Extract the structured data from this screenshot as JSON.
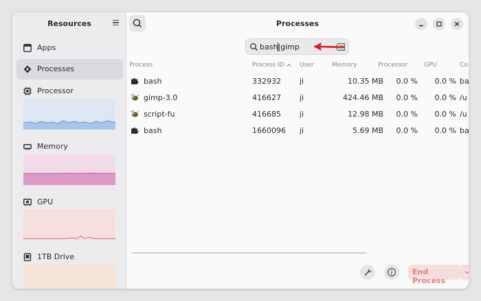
{
  "sidebar": {
    "title": "Resources",
    "items": [
      {
        "label": "Apps",
        "icon": "window-icon"
      },
      {
        "label": "Processes",
        "icon": "process-icon"
      },
      {
        "label": "Processor",
        "icon": "cpu-icon"
      },
      {
        "label": "Memory",
        "icon": "ram-icon"
      },
      {
        "label": "GPU",
        "icon": "gpu-icon"
      },
      {
        "label": "1TB Drive",
        "icon": "drive-icon"
      }
    ]
  },
  "header": {
    "title": "Processes"
  },
  "search": {
    "value": "bash|gimp"
  },
  "table": {
    "columns": [
      "Process",
      "Process ID",
      "User",
      "Memory",
      "Processor",
      "GPU",
      "Co"
    ],
    "rows": [
      {
        "name": "bash",
        "icon": "puzzle-icon",
        "pid": "332932",
        "user": "ji",
        "memory": "10.35 MB",
        "processor": "0.0 %",
        "gpu": "0.0 %",
        "command": "ba"
      },
      {
        "name": "gimp-3.0",
        "icon": "gimp-icon",
        "pid": "416627",
        "user": "ji",
        "memory": "424.46 MB",
        "processor": "0.0 %",
        "gpu": "0.0 %",
        "command": "/u"
      },
      {
        "name": "script-fu",
        "icon": "gimp-icon",
        "pid": "416685",
        "user": "ji",
        "memory": "12.98 MB",
        "processor": "0.0 %",
        "gpu": "0.0 %",
        "command": "/u"
      },
      {
        "name": "bash",
        "icon": "puzzle-icon",
        "pid": "1660096",
        "user": "ji",
        "memory": "5.69 MB",
        "processor": "0.0 %",
        "gpu": "0.0 %",
        "command": "ba"
      }
    ]
  },
  "footer": {
    "end_process_label": "End Process"
  },
  "colors": {
    "accent_processor": "#8fb8e8",
    "accent_memory": "#d98cc0",
    "accent_gpu": "#e86a6a",
    "danger": "#e08080"
  }
}
